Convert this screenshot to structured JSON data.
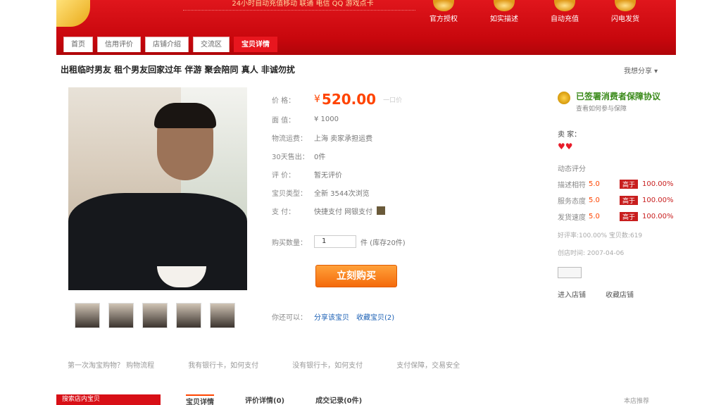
{
  "banner": {
    "slogan": "24小时自动充值移动 联通 电信 QQ 游戏点卡",
    "badges": [
      {
        "label": "官方授权"
      },
      {
        "label": "如实描述"
      },
      {
        "label": "自动充值"
      },
      {
        "label": "闪电发货"
      }
    ]
  },
  "tabs": [
    {
      "label": "首页"
    },
    {
      "label": "信用评价"
    },
    {
      "label": "店铺介绍"
    },
    {
      "label": "交流区"
    },
    {
      "label": "宝贝详情"
    }
  ],
  "product": {
    "title": "出租临时男友 租个男友回家过年 伴游 聚会陪同 真人 非诚勿扰",
    "share_top": "我想分享 ▾",
    "price_label": "价      格：",
    "currency": "¥",
    "price": "520.00",
    "price_aux": "一口价",
    "fields": [
      {
        "label": "面      值：",
        "value": "¥ 1000"
      },
      {
        "label": "物流运费：",
        "value": "上海  卖家承担运费"
      },
      {
        "label": "30天售出：",
        "value": "0件"
      },
      {
        "label": "评      价：",
        "value": "暂无评价"
      },
      {
        "label": "宝贝类型：",
        "value": "全新  3544次浏览"
      },
      {
        "label": "支      付：",
        "value": "快捷支付  网银支付"
      }
    ],
    "qty_label": "购买数量：",
    "qty_value": "1",
    "qty_stock": "件 (库存20件)",
    "buy_label": "立刻购买",
    "share_label": "你还可以：",
    "share_link": "分享该宝贝",
    "fav_link": "收藏宝贝(2)"
  },
  "seller": {
    "guarantee": "已签署消费者保障协议",
    "guarantee_sub": "查看如何参与保障",
    "name": "卖     家：",
    "hearts": "♥♥",
    "dsr_head": "动态评分",
    "dsr": [
      {
        "label": "描述相符",
        "score": "5.0",
        "tag": "高于",
        "pct": "100.00%"
      },
      {
        "label": "服务态度",
        "score": "5.0",
        "tag": "高于",
        "pct": "100.00%"
      },
      {
        "label": "发货速度",
        "score": "5.0",
        "tag": "高于",
        "pct": "100.00%"
      }
    ],
    "meta1": "好评率:100.00%  宝贝数:619",
    "meta2": "创店时间: 2007-04-06",
    "enter_shop": "进入店铺",
    "fav_shop": "收藏店铺"
  },
  "help": [
    "第一次淘宝购物？ 购物流程",
    "我有银行卡，如何支付",
    "没有银行卡，如何支付",
    "支付保障，交易安全"
  ],
  "bottom": {
    "search_label": "搜索店内宝贝",
    "tabs": [
      {
        "label": "宝贝详情"
      },
      {
        "label": "评价详情(0)"
      },
      {
        "label": "成交记录(0件)"
      }
    ],
    "right": "本店推荐"
  }
}
